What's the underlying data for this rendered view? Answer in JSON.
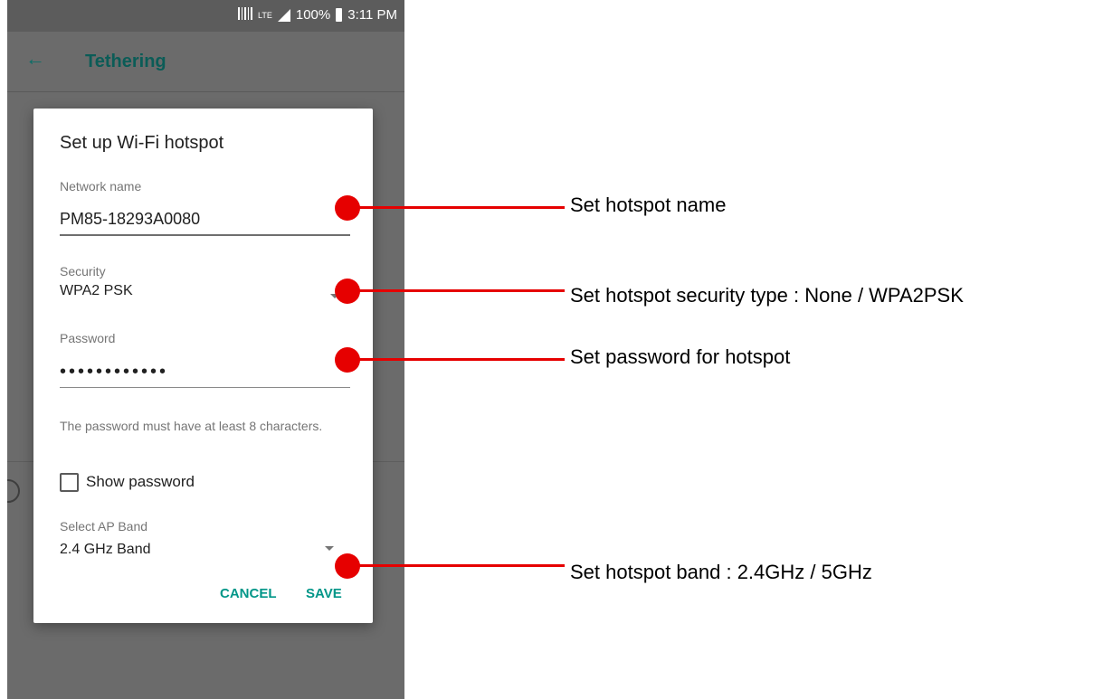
{
  "status_bar": {
    "lte_label": "LTE",
    "battery": "100%",
    "time": "3:11 PM"
  },
  "app_bar": {
    "title": "Tethering",
    "back_icon": "arrow-left-icon"
  },
  "dialog": {
    "title": "Set up Wi-Fi hotspot",
    "network_name": {
      "label": "Network name",
      "value": "PM85-18293A0080"
    },
    "security": {
      "label": "Security",
      "selected": "WPA2 PSK"
    },
    "password": {
      "label": "Password",
      "masked_value": "••••••••••••",
      "hint": "The password must have at least 8 characters."
    },
    "show_password": {
      "label": "Show password",
      "checked": false
    },
    "ap_band": {
      "label": "Select AP Band",
      "selected": "2.4 GHz Band"
    },
    "buttons": {
      "cancel": "CANCEL",
      "save": "SAVE"
    }
  },
  "callouts": [
    {
      "text": "Set hotspot name"
    },
    {
      "text": "Set hotspot security type : None / WPA2PSK"
    },
    {
      "text": "Set password for hotspot"
    },
    {
      "text": "Set hotspot band : 2.4GHz / 5GHz"
    }
  ],
  "colors": {
    "accent": "#009688",
    "callout": "#e60000",
    "overlay": "#6b6b6b"
  }
}
